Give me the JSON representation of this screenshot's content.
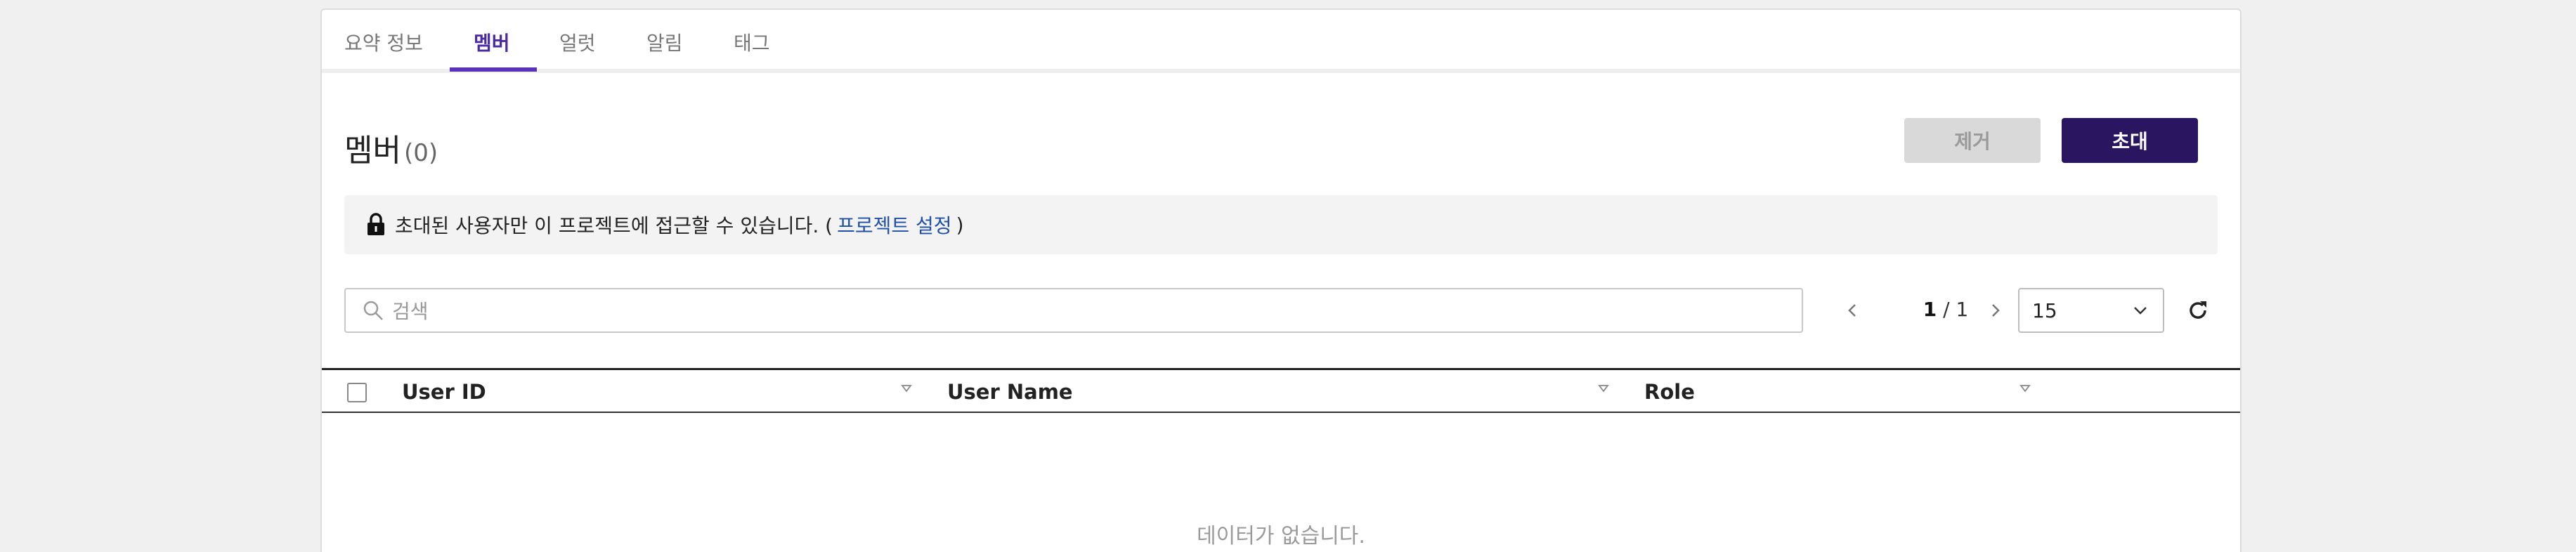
{
  "tabs": [
    {
      "label": "요약 정보",
      "active": false
    },
    {
      "label": "멤버",
      "active": true
    },
    {
      "label": "얼럿",
      "active": false
    },
    {
      "label": "알림",
      "active": false
    },
    {
      "label": "태그",
      "active": false
    }
  ],
  "header": {
    "title": "멤버",
    "count": "(0)"
  },
  "actions": {
    "remove_label": "제거",
    "invite_label": "초대"
  },
  "notice": {
    "text": "초대된 사용자만 이 프로젝트에 접근할 수 있습니다. (",
    "link": "프로젝트 설정",
    "close": ")"
  },
  "search": {
    "placeholder": "검색"
  },
  "pagination": {
    "current": "1",
    "separator": " / ",
    "total": "1",
    "page_size": "15"
  },
  "table": {
    "columns": [
      "User ID",
      "User Name",
      "Role"
    ],
    "empty_text": "데이터가 없습니다."
  },
  "colors": {
    "accent": "#5a32b8",
    "invite_button": "#2a1660",
    "link": "#1f50a8"
  },
  "icons": [
    "lock-icon",
    "search-icon",
    "chevron-left-icon",
    "chevron-right-icon",
    "chevron-down-icon",
    "refresh-icon",
    "sort-icon"
  ]
}
